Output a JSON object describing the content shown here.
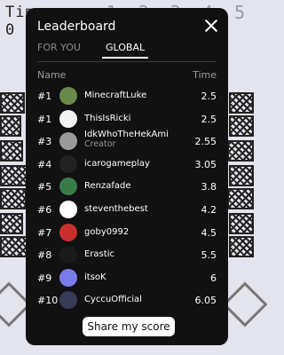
{
  "background": {
    "title_text": "Time",
    "score_text": "0",
    "digits_text": "1 2 3 4 5"
  },
  "modal": {
    "title": "Leaderboard",
    "tabs": [
      {
        "label": "FOR YOU",
        "active": false
      },
      {
        "label": "GLOBAL",
        "active": true
      }
    ],
    "columns": {
      "name": "Name",
      "time": "Time"
    },
    "rows": [
      {
        "rank": "#1",
        "name": "MinecraftLuke",
        "sub": "",
        "time": "2.5",
        "avatar_color": "#6a8a4a"
      },
      {
        "rank": "#1",
        "name": "ThisIsRicki",
        "sub": "",
        "time": "2.5",
        "avatar_color": "#f2f2f2"
      },
      {
        "rank": "#3",
        "name": "IdkWhoTheHekAmi",
        "sub": "Creator",
        "time": "2.55",
        "avatar_color": "#9a9a9a"
      },
      {
        "rank": "#4",
        "name": "icarogameplay",
        "sub": "",
        "time": "3.05",
        "avatar_color": "#222222"
      },
      {
        "rank": "#5",
        "name": "Renzafade",
        "sub": "",
        "time": "3.8",
        "avatar_color": "#3a7a4a"
      },
      {
        "rank": "#6",
        "name": "steventhebest",
        "sub": "",
        "time": "4.2",
        "avatar_color": "#ffffff"
      },
      {
        "rank": "#7",
        "name": "goby0992",
        "sub": "",
        "time": "4.5",
        "avatar_color": "#c83030"
      },
      {
        "rank": "#8",
        "name": "Erastic",
        "sub": "",
        "time": "5.5",
        "avatar_color": "#1a1a1a"
      },
      {
        "rank": "#9",
        "name": "itsoK",
        "sub": "",
        "time": "6",
        "avatar_color": "#7a7ae8"
      },
      {
        "rank": "#10",
        "name": "CyccuOfficial",
        "sub": "",
        "time": "6.05",
        "avatar_color": "#3a3a5a"
      }
    ],
    "share_label": "Share my score"
  },
  "icons": {
    "close": "close-icon"
  }
}
